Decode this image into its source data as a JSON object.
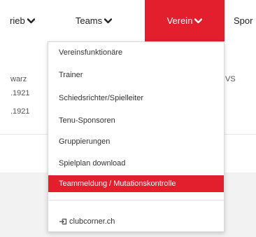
{
  "nav": {
    "items": [
      {
        "label": "rieb"
      },
      {
        "label": "Teams"
      },
      {
        "label": "Verein"
      },
      {
        "label": "Spor"
      }
    ],
    "active_color": "#e31e2d"
  },
  "background": {
    "col1": [
      "warz",
      ".1921",
      ".1921"
    ],
    "col2": "VS"
  },
  "dropdown": {
    "items": [
      {
        "label": "Vereinsfunktionäre"
      },
      {
        "label": "Trainer"
      },
      {
        "label": "Schiedsrichter/Spielleiter"
      },
      {
        "label": "Tenu-Sponsoren"
      },
      {
        "label": "Gruppierungen"
      },
      {
        "label": "Spielplan download"
      },
      {
        "label": "Teammeldung / Mutationskontrolle"
      },
      {
        "label": "clubcorner.ch",
        "icon": "external-link-icon"
      }
    ],
    "highlight_color": "#e31e2d"
  }
}
